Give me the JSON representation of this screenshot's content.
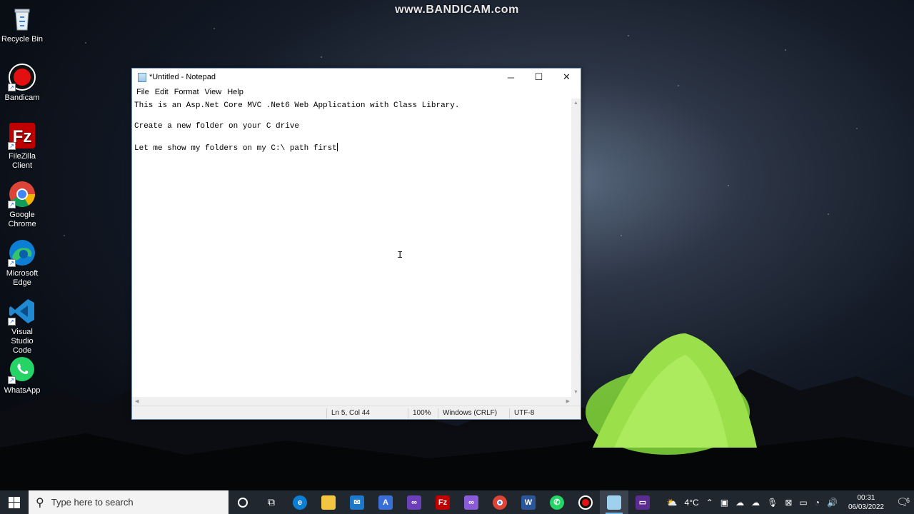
{
  "watermark": "www.BANDICAM.com",
  "desktop": {
    "icons": [
      {
        "name": "recycle-bin",
        "label_line1": "Recycle Bin",
        "label_line2": ""
      },
      {
        "name": "bandicam",
        "label_line1": "Bandicam",
        "label_line2": ""
      },
      {
        "name": "filezilla",
        "label_line1": "FileZilla",
        "label_line2": "Client"
      },
      {
        "name": "chrome",
        "label_line1": "Google",
        "label_line2": "Chrome"
      },
      {
        "name": "edge",
        "label_line1": "Microsoft",
        "label_line2": "Edge"
      },
      {
        "name": "vscode",
        "label_line1": "Visual Studio",
        "label_line2": "Code"
      },
      {
        "name": "whatsapp",
        "label_line1": "WhatsApp",
        "label_line2": ""
      }
    ]
  },
  "notepad": {
    "title": "*Untitled - Notepad",
    "menu": [
      "File",
      "Edit",
      "Format",
      "View",
      "Help"
    ],
    "lines": [
      "This is an Asp.Net Core MVC .Net6 Web Application with Class Library.",
      "",
      "Create a new folder on your C drive",
      "",
      "Let me show my folders on my C:\\ path first"
    ],
    "status": {
      "position": "Ln 5, Col 44",
      "zoom": "100%",
      "line_ending": "Windows (CRLF)",
      "encoding": "UTF-8"
    }
  },
  "taskbar": {
    "search_placeholder": "Type here to search",
    "weather": "4°C",
    "time": "00:31",
    "date": "06/03/2022",
    "notification_count": "6"
  },
  "colors": {
    "taskbar_bg": "#20272f",
    "window_border": "#6c8cb5",
    "active_indicator": "#76b9ed"
  }
}
